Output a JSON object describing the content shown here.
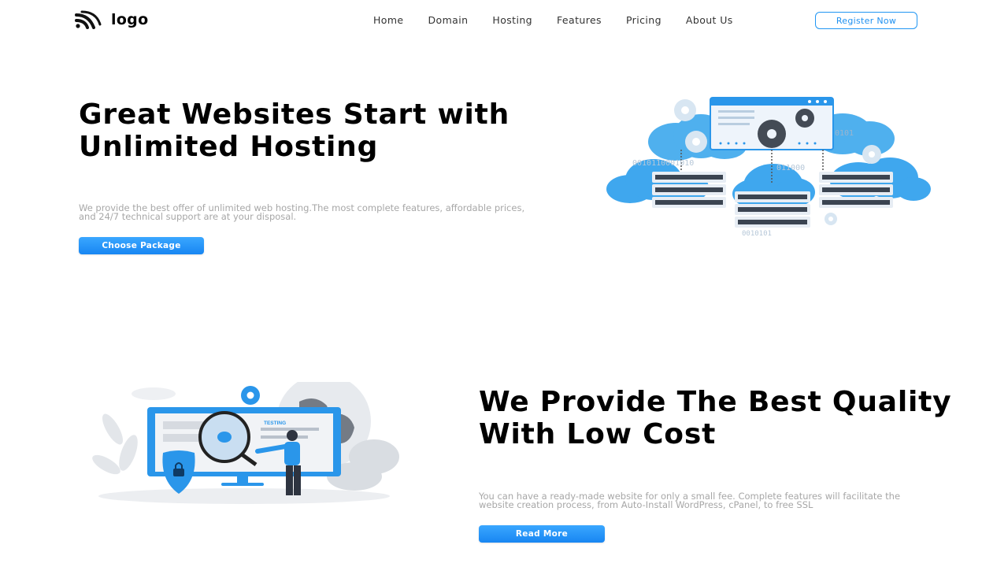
{
  "brand": {
    "logo_text": "logo",
    "accent_color": "#1e90f0"
  },
  "nav": {
    "items": [
      "Home",
      "Domain",
      "Hosting",
      "Features",
      "Pricing",
      "About Us"
    ],
    "register_label": "Register Now"
  },
  "hero": {
    "title": "Great Websites Start with Unlimited Hosting",
    "description": "We provide the best offer of unlimited web hosting.The most complete features, affordable prices, and 24/7 technical support are at your disposal.",
    "cta_label": "Choose Package",
    "illustration_binary": [
      "0101",
      "0010110001010",
      "011000",
      "0010101"
    ]
  },
  "quality": {
    "title": "We Provide The Best Quality With Low Cost",
    "description": "You can have a ready-made website for only a small fee. Complete features will facilitate the website creation process, from Auto-Install WordPress, cPanel, to free SSL",
    "cta_label": "Read More",
    "illustration_label": "TESTING"
  }
}
